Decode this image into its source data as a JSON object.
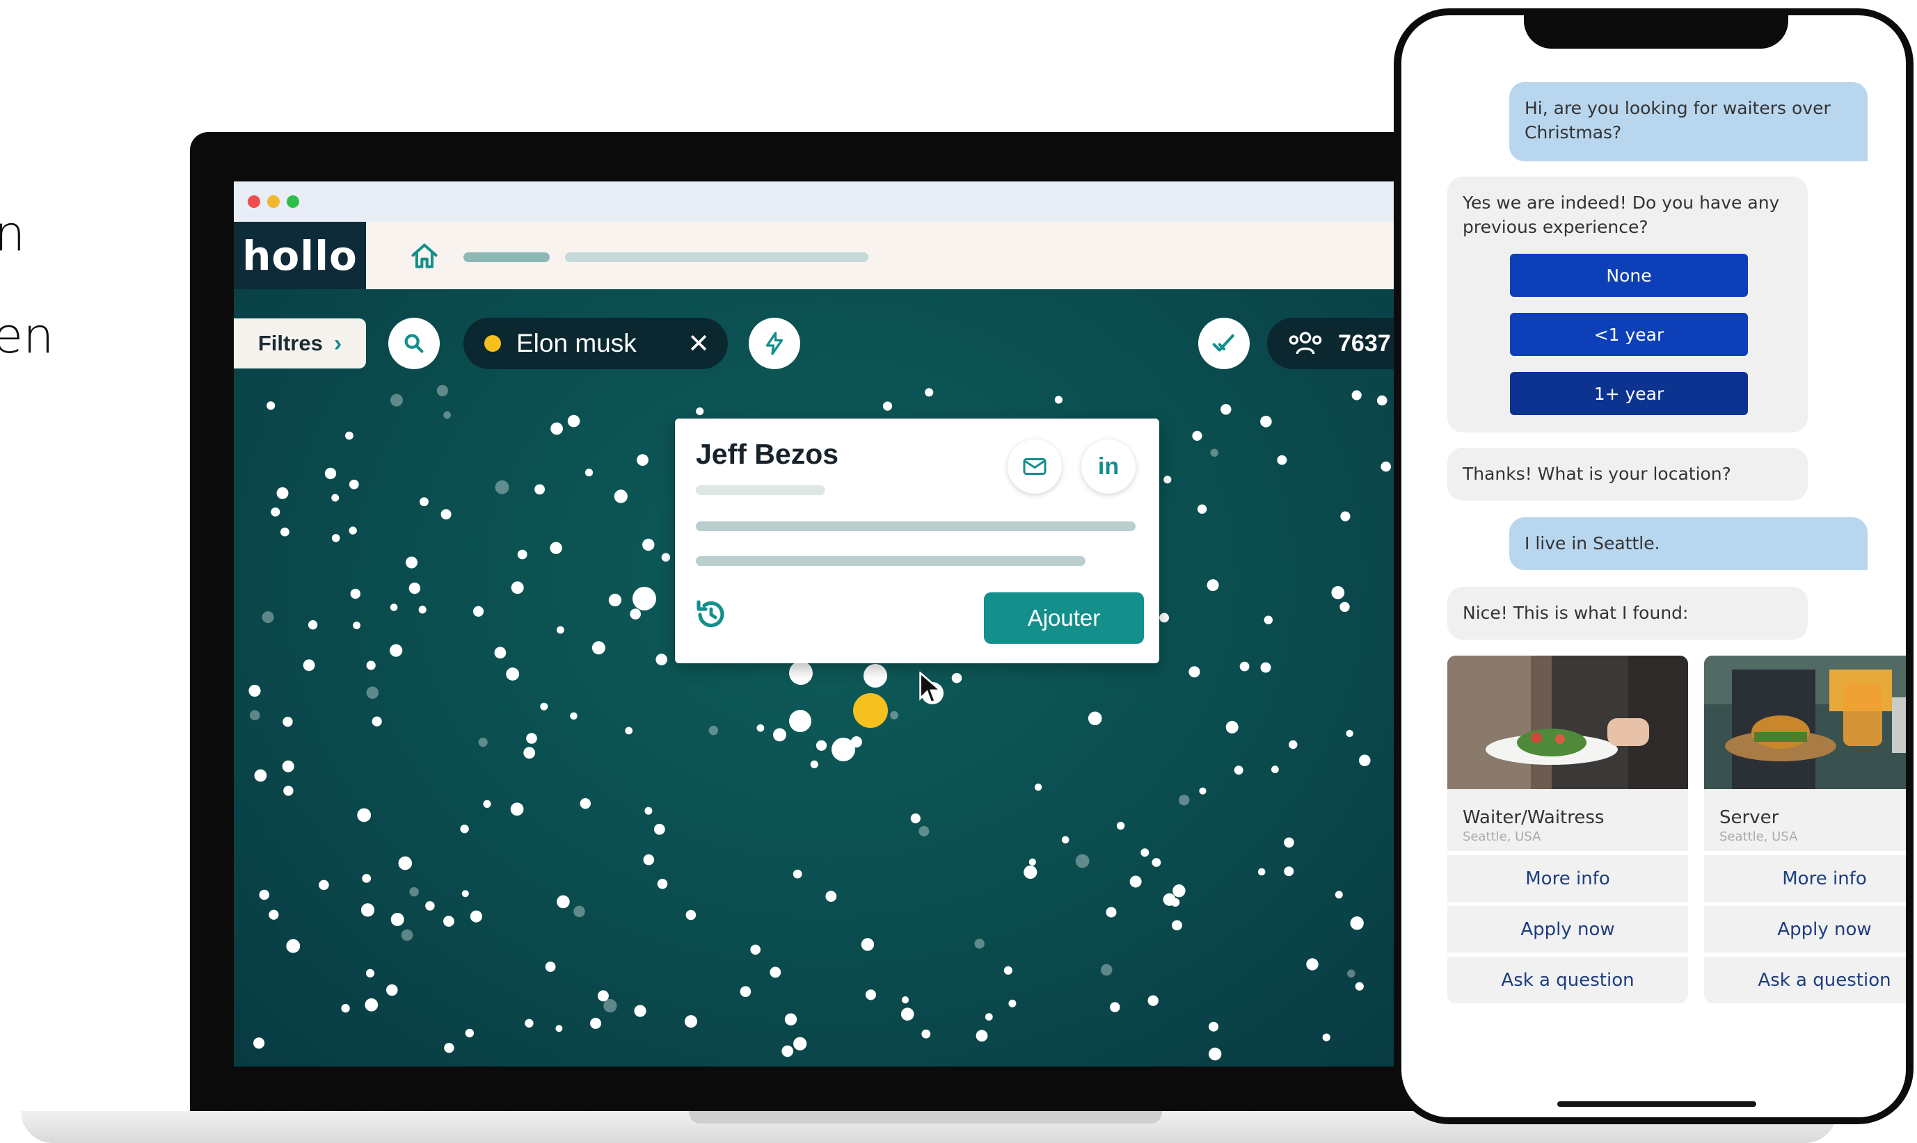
{
  "side_text": [
    "n",
    "en",
    ":"
  ],
  "app": {
    "logo": "hollo",
    "filter_label": "Filtres",
    "search_chip": "Elon musk",
    "count": "7637",
    "card": {
      "name": "Jeff Bezos",
      "add_label": "Ajouter"
    }
  },
  "chat": {
    "q1": "Hi, are you looking for waiters over Christmas?",
    "a1": "Yes we are indeed! Do you have any previous experience?",
    "options": [
      "None",
      "<1 year",
      "1+ year"
    ],
    "a2": "Thanks! What is your location?",
    "q2": "I live in Seattle.",
    "a3": "Nice! This is what I found:",
    "jobs": [
      {
        "title": "Waiter/Waitress",
        "location": "Seattle, USA",
        "actions": [
          "More info",
          "Apply now",
          "Ask a question"
        ]
      },
      {
        "title": "Server",
        "location": "Seattle, USA",
        "actions": [
          "More info",
          "Apply now",
          "Ask a question"
        ]
      }
    ]
  },
  "colors": {
    "teal": "#138f8c",
    "dark_navy": "#0b2730",
    "chip_yellow": "#f6c01f",
    "option_blue": "#0d40b8",
    "user_bubble": "#b9d6ef"
  }
}
